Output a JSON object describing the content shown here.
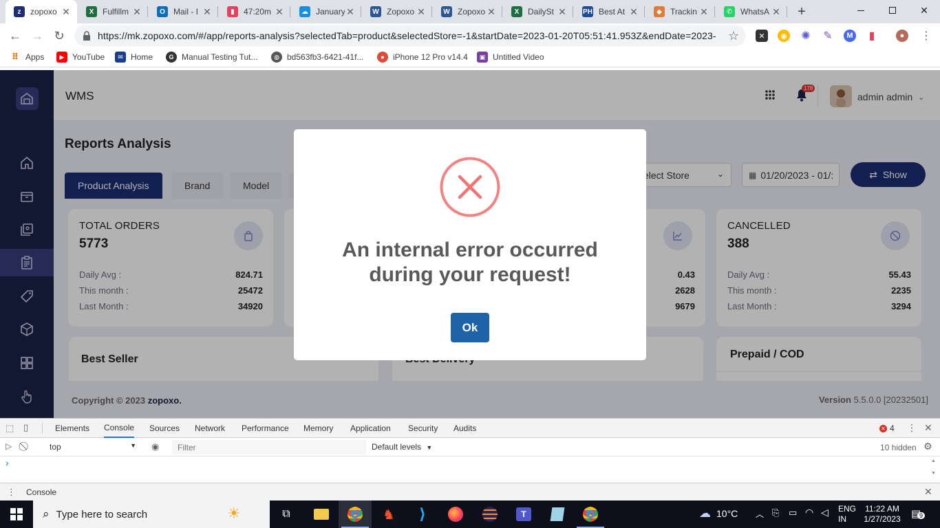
{
  "browser": {
    "tabs": [
      {
        "label": "zopoxo",
        "icon": "zopoxo-icon",
        "color": "#1b2e74",
        "glyph": "z",
        "active": true
      },
      {
        "label": "Fulfillm",
        "icon": "excel-icon",
        "color": "#1d6f42",
        "glyph": "X"
      },
      {
        "label": "Mail - I",
        "icon": "outlook-icon",
        "color": "#0f6cbd",
        "glyph": "O"
      },
      {
        "label": "47:20m",
        "icon": "recorder-icon",
        "color": "#e2445c",
        "glyph": "▮"
      },
      {
        "label": "January",
        "icon": "onedrive-icon",
        "color": "#1490df",
        "glyph": "☁"
      },
      {
        "label": "Zopoxo",
        "icon": "word-icon",
        "color": "#2b579a",
        "glyph": "W"
      },
      {
        "label": "Zopoxo",
        "icon": "word-icon",
        "color": "#2b579a",
        "glyph": "W"
      },
      {
        "label": "DailySt",
        "icon": "excel-icon",
        "color": "#1d6f42",
        "glyph": "X"
      },
      {
        "label": "Best At",
        "icon": "ph-icon",
        "color": "#1d4ba0",
        "glyph": "PH"
      },
      {
        "label": "Trackin",
        "icon": "tracking-icon",
        "color": "#e07b39",
        "glyph": "◆"
      },
      {
        "label": "WhatsA",
        "icon": "whatsapp-icon",
        "color": "#25d366",
        "glyph": "✆"
      }
    ],
    "new_tab_glyph": "+",
    "url": "https://mk.zopoxo.com/#/app/reports-analysis?selectedTab=product&selectedStore=-1&startDate=2023-01-20T05:51:41.953Z&endDate=2023-...",
    "bookmarks": [
      {
        "label": "Apps",
        "icon": "apps-grid-icon"
      },
      {
        "label": "YouTube",
        "icon": "youtube-icon"
      },
      {
        "label": "Home",
        "icon": "home-mail-icon"
      },
      {
        "label": "Manual Testing Tut...",
        "icon": "g-icon"
      },
      {
        "label": "bd563fb3-6421-41f...",
        "icon": "globe-icon"
      },
      {
        "label": "iPhone 12 Pro v14.4",
        "icon": "chrome-icon"
      },
      {
        "label": "Untitled Video",
        "icon": "video-icon"
      }
    ]
  },
  "app": {
    "brand": "WMS",
    "notification_count": "178",
    "user_name": "admin admin",
    "page_title": "Reports Analysis",
    "tabs": [
      "Product Analysis",
      "Brand",
      "Model"
    ],
    "store_select": "elect Store",
    "date_range": "01/20/2023 - 01/:",
    "show_button": "Show",
    "cards": {
      "total": {
        "title": "TOTAL ORDERS",
        "value": "5773",
        "rows": [
          {
            "label": "Daily Avg :",
            "value": "824.71"
          },
          {
            "label": "This month :",
            "value": "25472"
          },
          {
            "label": "Last Month :",
            "value": "34920"
          }
        ]
      },
      "third": {
        "values": [
          "0.43",
          "2628",
          "9679"
        ]
      },
      "cancelled": {
        "title": "CANCELLED",
        "value": "388",
        "rows": [
          {
            "label": "Daily Avg :",
            "value": "55.43"
          },
          {
            "label": "This month :",
            "value": "2235"
          },
          {
            "label": "Last Month :",
            "value": "3294"
          }
        ]
      }
    },
    "best_seller": "Best Seller",
    "best_delivery": "Best Delivery",
    "prepaid_cod": "Prepaid / COD",
    "footer_copyright": "Copyright © 2023",
    "footer_brand": "zopoxo.",
    "footer_version_label": "Version",
    "footer_version": "5.5.0.0 [20232501]"
  },
  "modal": {
    "message_line1": "An internal error occurred",
    "message_line2": "during your request!",
    "ok_label": "Ok",
    "error_color": "#f27474",
    "ok_color": "#1e63a8"
  },
  "devtools": {
    "tabs": [
      "Elements",
      "Console",
      "Sources",
      "Network",
      "Performance",
      "Memory",
      "Application",
      "Security",
      "Audits"
    ],
    "active_tab": "Console",
    "error_count": "4",
    "context": "top",
    "filter_placeholder": "Filter",
    "levels": "Default levels",
    "hidden": "10 hidden",
    "prompt": "›",
    "drawer_label": "Console"
  },
  "taskbar": {
    "search_placeholder": "Type here to search",
    "weather": "10°C",
    "lang_line1": "ENG",
    "lang_line2": "IN",
    "time": "11:22 AM",
    "date": "1/27/2023",
    "notif_count": "9"
  }
}
